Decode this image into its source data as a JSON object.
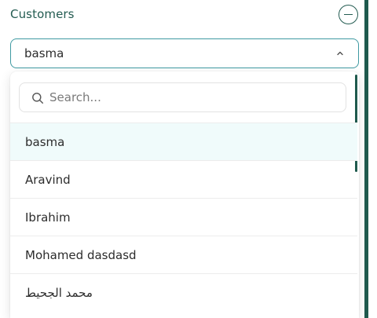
{
  "section": {
    "title": "Customers"
  },
  "select": {
    "value": "basma"
  },
  "dropdown": {
    "search_placeholder": "Search...",
    "options": [
      {
        "label": "basma",
        "selected": true
      },
      {
        "label": "Aravind",
        "selected": false
      },
      {
        "label": "Ibrahim",
        "selected": false
      },
      {
        "label": "Mohamed dasdasd",
        "selected": false
      },
      {
        "label": "محمد الجحيط",
        "selected": false
      }
    ]
  },
  "colors": {
    "accent": "#245c52",
    "focus_border": "#3f9aa2",
    "selected_bg": "#f0fbfb"
  },
  "icons": {
    "collapse": "minus-circle-icon",
    "chevron": "chevron-up-icon",
    "search": "search-icon"
  }
}
